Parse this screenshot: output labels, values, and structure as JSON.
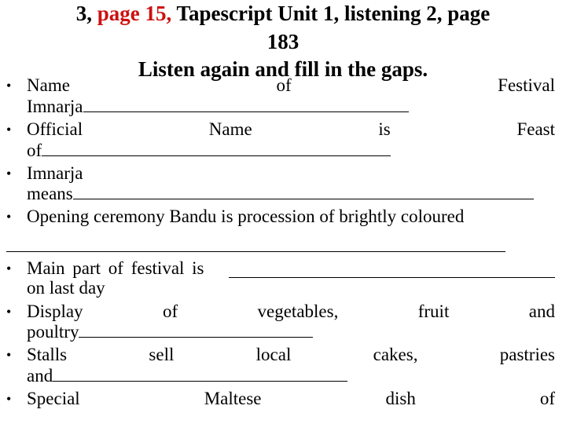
{
  "title": {
    "prefix": "3,",
    "highlight": "page 15,",
    "rest": "Tapescript Unit 1, listening 2, page",
    "line2": "183",
    "line3": "Listen again and fill in the gaps."
  },
  "colors": {
    "highlight": "#cc1111",
    "text": "#000000"
  },
  "bullet_glyph": "•",
  "items": [
    {
      "words": [
        "Name",
        "of",
        "Festival"
      ],
      "cont": "Imnarja"
    },
    {
      "words": [
        "Official",
        "Name",
        "is",
        "Feast"
      ],
      "cont": "of"
    },
    {
      "words": [
        "Imnarja"
      ],
      "cont": "means"
    },
    {
      "words": [
        "Opening ceremony Bandu is procession of brightly coloured"
      ]
    },
    {
      "text": "Main part of festival is",
      "cont": "on last day"
    },
    {
      "words": [
        "Display",
        "of",
        "vegetables,",
        "fruit",
        "and"
      ],
      "cont": "poultry"
    },
    {
      "words": [
        "Stalls",
        "sell",
        "local",
        "cakes,",
        "pastries"
      ],
      "cont": "and"
    },
    {
      "words": [
        "Special",
        "Maltese",
        "dish",
        "of"
      ]
    }
  ]
}
